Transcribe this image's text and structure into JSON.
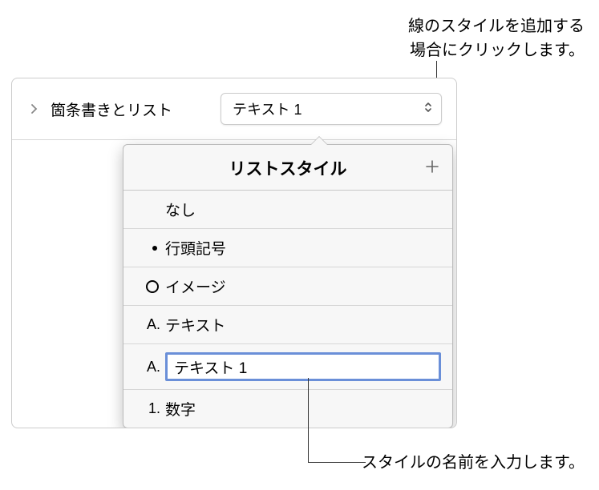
{
  "callouts": {
    "top_line1": "線のスタイルを追加する",
    "top_line2": "場合にクリックします。",
    "bottom": "スタイルの名前を入力します。"
  },
  "panel": {
    "row_label": "箇条書きとリスト",
    "dropdown_value": "テキスト 1"
  },
  "popover": {
    "title": "リストスタイル",
    "items": {
      "none": {
        "label": "なし",
        "marker": ""
      },
      "bullet": {
        "label": "行頭記号",
        "marker_type": "dot"
      },
      "image": {
        "label": "イメージ",
        "marker_type": "circle"
      },
      "text": {
        "label": "テキスト",
        "marker": "A."
      },
      "text_editing": {
        "value": "テキスト 1",
        "marker": "A."
      },
      "number": {
        "label": "数字",
        "marker": "1."
      }
    }
  }
}
